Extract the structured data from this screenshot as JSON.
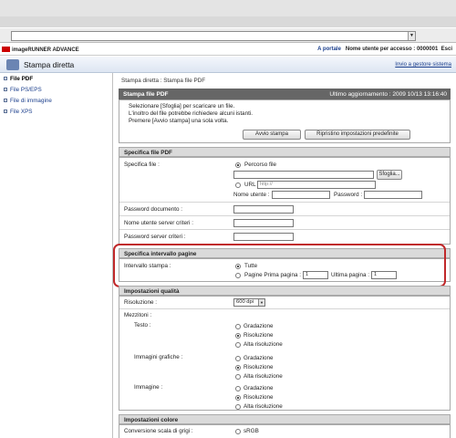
{
  "header": {
    "product": "imageRUNNER ADVANCE",
    "portal_link": "A portale",
    "user_label": "Nome utente per accesso : 0000001",
    "logout_link": "Esci"
  },
  "titlebar": {
    "title": "Stampa diretta",
    "system_link": "Invio a gestore sistema"
  },
  "sidebar": {
    "items": [
      {
        "label": "File PDF"
      },
      {
        "label": "File PS/EPS"
      },
      {
        "label": "File di immagine"
      },
      {
        "label": "File XPS"
      }
    ]
  },
  "breadcrumb": "Stampa diretta : Stampa file PDF",
  "print_panel": {
    "title": "Stampa file PDF",
    "updated": "Ultimo aggiornamento : 2009 10/13 13:16:40",
    "instructions": [
      "Selezionare [Sfoglia] per scaricare un file.",
      "L'inoltro del file potrebbe richiedere alcuni istanti.",
      "Premere [Avvio stampa] una sola volta."
    ],
    "start_button": "Avvio stampa",
    "reset_button": "Ripristino impostazioni predefinite"
  },
  "file_spec": {
    "heading": "Specifica file PDF",
    "file_label": "Specifica file :",
    "path_option": "Percorso file",
    "browse_button": "Sfoglia...",
    "url_option": "URL",
    "url_placeholder": "http://",
    "username_label": "Nome utente :",
    "password_label": "Password :",
    "doc_password_label": "Password documento :",
    "server_user_label": "Nome utente server criteri :",
    "server_password_label": "Password server criteri :"
  },
  "page_range": {
    "heading": "Specifica intervallo pagine",
    "label": "Intervallo stampa :",
    "all_option": "Tutte",
    "pages_option": "Pagine  Prima pagina :",
    "first_value": "1",
    "last_label": "Ultima pagina :",
    "last_value": "1"
  },
  "quality": {
    "heading": "Impostazioni qualità",
    "resolution_label": "Risoluzione :",
    "resolution_value": "600 dpi",
    "halftone_label": "Mezzitoni :",
    "groups": [
      {
        "label": "Testo :",
        "options": [
          "Gradazione",
          "Risoluzione",
          "Alta risoluzione"
        ],
        "selected": 1
      },
      {
        "label": "Immagini grafiche :",
        "options": [
          "Gradazione",
          "Risoluzione",
          "Alta risoluzione"
        ],
        "selected": 1
      },
      {
        "label": "Immagine :",
        "options": [
          "Gradazione",
          "Risoluzione",
          "Alta risoluzione"
        ],
        "selected": 1
      }
    ]
  },
  "color": {
    "heading": "Impostazioni colore",
    "grayscale_label": "Conversione scala di grigi :",
    "option_srgb": "sRGB"
  }
}
